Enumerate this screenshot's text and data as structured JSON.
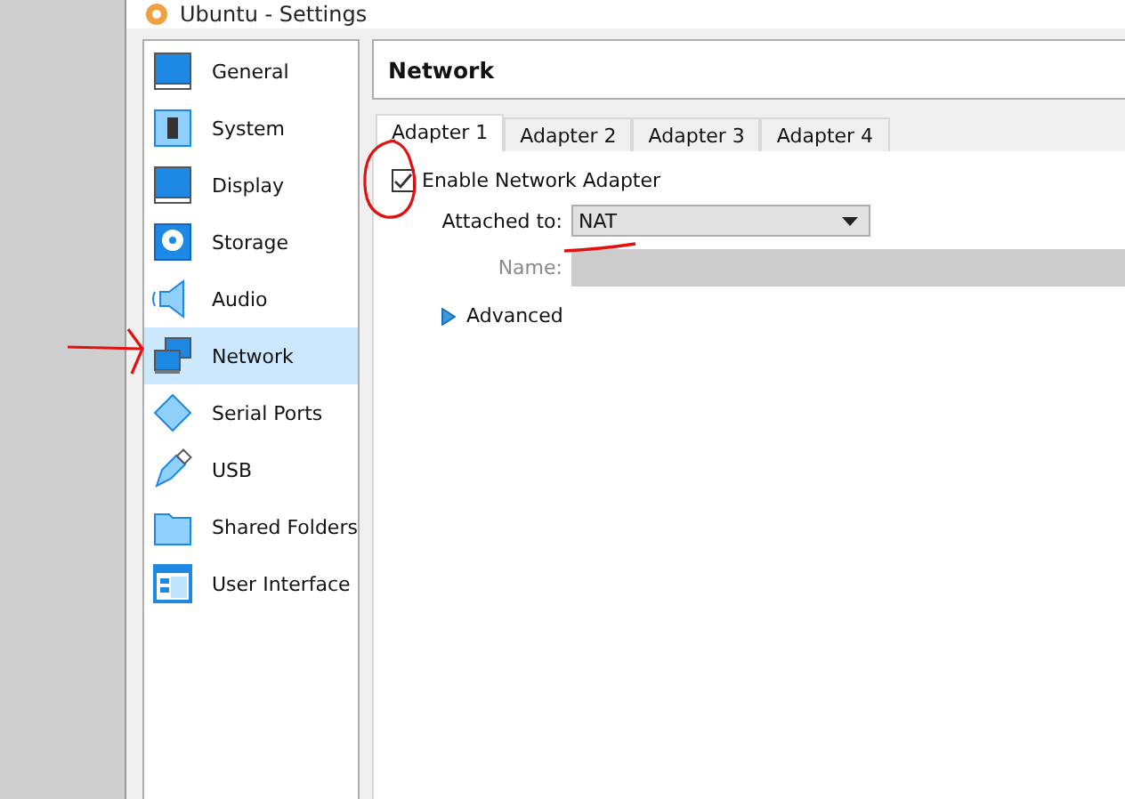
{
  "window": {
    "title": "Ubuntu - Settings"
  },
  "sidebar": {
    "items": [
      {
        "label": "General",
        "selected": false
      },
      {
        "label": "System",
        "selected": false
      },
      {
        "label": "Display",
        "selected": false
      },
      {
        "label": "Storage",
        "selected": false
      },
      {
        "label": "Audio",
        "selected": false
      },
      {
        "label": "Network",
        "selected": true
      },
      {
        "label": "Serial Ports",
        "selected": false
      },
      {
        "label": "USB",
        "selected": false
      },
      {
        "label": "Shared Folders",
        "selected": false
      },
      {
        "label": "User Interface",
        "selected": false
      }
    ]
  },
  "header": {
    "title": "Network"
  },
  "tabs": [
    {
      "label": "Adapter 1",
      "selected": true
    },
    {
      "label": "Adapter 2",
      "selected": false
    },
    {
      "label": "Adapter 3",
      "selected": false
    },
    {
      "label": "Adapter 4",
      "selected": false
    }
  ],
  "adapter": {
    "enable": {
      "label": "Enable Network Adapter",
      "checked": true
    },
    "attached_to": {
      "label": "Attached to:",
      "value": "NAT"
    },
    "name": {
      "label": "Name:",
      "disabled": true
    },
    "advanced": {
      "label": "Advanced",
      "expanded": false
    }
  }
}
